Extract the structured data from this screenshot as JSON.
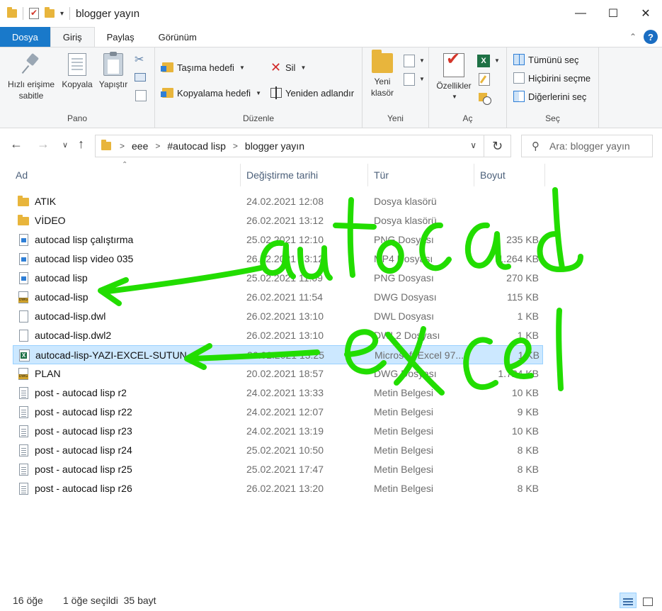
{
  "window": {
    "title": "blogger yayın"
  },
  "tabs": [
    "Dosya",
    "Giriş",
    "Paylaş",
    "Görünüm"
  ],
  "ribbon": {
    "pano": {
      "label": "Pano",
      "pin": "Hızlı erişime sabitle",
      "pin_line1": "Hızlı erişime",
      "pin_line2": "sabitle",
      "copy": "Kopyala",
      "paste": "Yapıştır"
    },
    "duzenle": {
      "label": "Düzenle",
      "move_to": "Taşıma hedefi",
      "copy_to": "Kopyalama hedefi",
      "delete": "Sil",
      "rename": "Yeniden adlandır"
    },
    "yeni": {
      "label": "Yeni",
      "new_folder_line1": "Yeni",
      "new_folder_line2": "klasör"
    },
    "ac": {
      "label": "Aç",
      "properties": "Özellikler"
    },
    "sec": {
      "label": "Seç",
      "select_all": "Tümünü seç",
      "select_none": "Hiçbirini seçme",
      "invert": "Diğerlerini seç"
    }
  },
  "address": {
    "crumbs": [
      "eee",
      "#autocad lisp",
      "blogger yayın"
    ],
    "search_placeholder": "Ara: blogger yayın"
  },
  "columns": {
    "name": "Ad",
    "date": "Değiştirme tarihi",
    "type": "Tür",
    "size": "Boyut"
  },
  "files": [
    {
      "name": "ATIK",
      "date": "24.02.2021 12:08",
      "type": "Dosya klasörü",
      "size": "",
      "icon": "folder-icon"
    },
    {
      "name": "VİDEO",
      "date": "26.02.2021 13:12",
      "type": "Dosya klasörü",
      "size": "",
      "icon": "folder-icon"
    },
    {
      "name": "autocad lisp çalıştırma",
      "date": "25.02.2021 12:10",
      "type": "PNG Dosyası",
      "size": "235 KB",
      "icon": "png-file-icon"
    },
    {
      "name": "autocad lisp video 035",
      "date": "26.02.2021 13:12",
      "type": "MP4 Dosyası",
      "size": "1.264 KB",
      "icon": "png-file-icon"
    },
    {
      "name": "autocad lisp",
      "date": "25.02.2021 11:09",
      "type": "PNG Dosyası",
      "size": "270 KB",
      "icon": "png-file-icon"
    },
    {
      "name": "autocad-lisp",
      "date": "26.02.2021 11:54",
      "type": "DWG Dosyası",
      "size": "115 KB",
      "icon": "dwg-file-icon"
    },
    {
      "name": "autocad-lisp.dwl",
      "date": "26.02.2021 13:10",
      "type": "DWL Dosyası",
      "size": "1 KB",
      "icon": "blank-file-icon"
    },
    {
      "name": "autocad-lisp.dwl2",
      "date": "26.02.2021 13:10",
      "type": "DWL2 Dosyası",
      "size": "1 KB",
      "icon": "blank-file-icon"
    },
    {
      "name": "autocad-lisp-YAZI-EXCEL-SUTUN",
      "date": "26.02.2021 13:25",
      "type": "Microsoft Excel 97...",
      "size": "1 KB",
      "icon": "excel-file-icon",
      "selected": true
    },
    {
      "name": "PLAN",
      "date": "20.02.2021 18:57",
      "type": "DWG Dosyası",
      "size": "1.724 KB",
      "icon": "dwg-file-icon"
    },
    {
      "name": "post - autocad lisp r2",
      "date": "24.02.2021 13:33",
      "type": "Metin Belgesi",
      "size": "10 KB",
      "icon": "text-file-icon"
    },
    {
      "name": "post - autocad lisp r22",
      "date": "24.02.2021 12:07",
      "type": "Metin Belgesi",
      "size": "9 KB",
      "icon": "text-file-icon"
    },
    {
      "name": "post - autocad lisp r23",
      "date": "24.02.2021 13:19",
      "type": "Metin Belgesi",
      "size": "10 KB",
      "icon": "text-file-icon"
    },
    {
      "name": "post - autocad lisp r24",
      "date": "25.02.2021 10:50",
      "type": "Metin Belgesi",
      "size": "8 KB",
      "icon": "text-file-icon"
    },
    {
      "name": "post - autocad lisp r25",
      "date": "25.02.2021 17:47",
      "type": "Metin Belgesi",
      "size": "8 KB",
      "icon": "text-file-icon"
    },
    {
      "name": "post - autocad lisp r26",
      "date": "26.02.2021 13:20",
      "type": "Metin Belgesi",
      "size": "8 KB",
      "icon": "text-file-icon"
    }
  ],
  "status": {
    "count": "16 öğe",
    "selected": "1 öğe seçildi  35 bayt"
  },
  "annotations": {
    "word1": "autocad",
    "word2": "excel",
    "color": "#22dd00"
  },
  "colors": {
    "file_tab": "#1979ca",
    "selection": "#cce8ff",
    "selection_border": "#99d1ff",
    "folder": "#e8b53c"
  }
}
